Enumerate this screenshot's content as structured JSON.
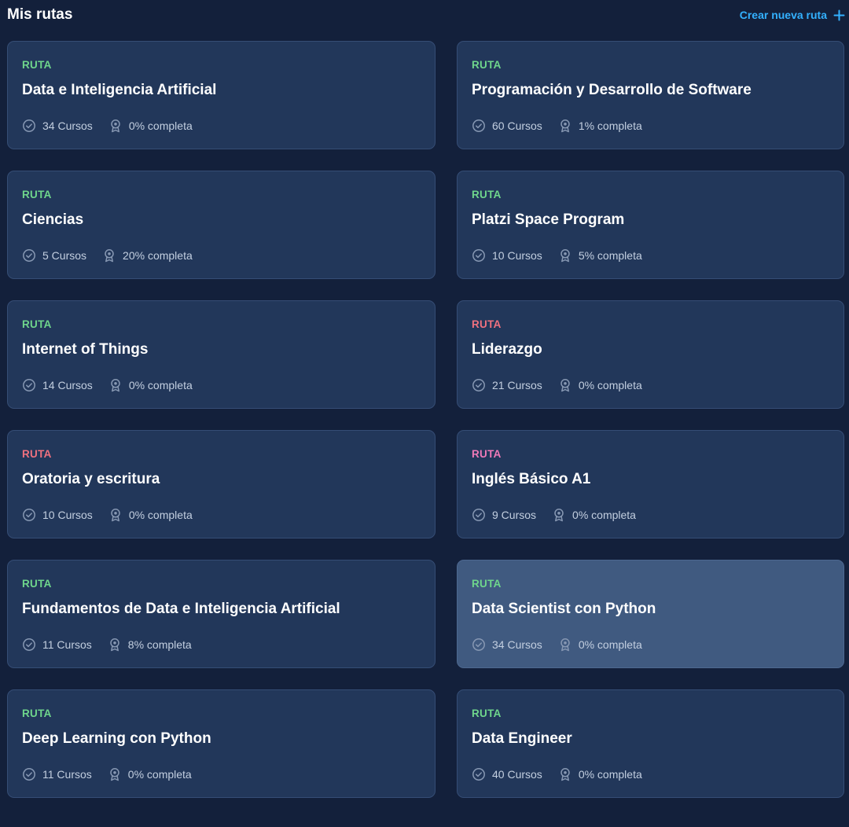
{
  "header": {
    "title": "Mis rutas",
    "create_label": "Crear nueva ruta"
  },
  "colors": {
    "green": "#6fd68c",
    "red": "#f0717f",
    "pink": "#f07ab8",
    "accent": "#33b1ff"
  },
  "routes": [
    {
      "tag": "RUTA",
      "tag_color": "green",
      "title": "Data e Inteligencia Artificial",
      "courses": "34 Cursos",
      "progress": "0% completa"
    },
    {
      "tag": "RUTA",
      "tag_color": "green",
      "title": "Programación y Desarrollo de Software",
      "courses": "60 Cursos",
      "progress": "1% completa"
    },
    {
      "tag": "RUTA",
      "tag_color": "green",
      "title": "Ciencias",
      "courses": "5 Cursos",
      "progress": "20% completa"
    },
    {
      "tag": "RUTA",
      "tag_color": "green",
      "title": "Platzi Space Program",
      "courses": "10 Cursos",
      "progress": "5% completa"
    },
    {
      "tag": "RUTA",
      "tag_color": "green",
      "title": "Internet of Things",
      "courses": "14 Cursos",
      "progress": "0% completa"
    },
    {
      "tag": "RUTA",
      "tag_color": "red",
      "title": "Liderazgo",
      "courses": "21 Cursos",
      "progress": "0% completa"
    },
    {
      "tag": "RUTA",
      "tag_color": "red",
      "title": "Oratoria y escritura",
      "courses": "10 Cursos",
      "progress": "0% completa"
    },
    {
      "tag": "RUTA",
      "tag_color": "pink",
      "title": "Inglés Básico A1",
      "courses": "9 Cursos",
      "progress": "0% completa"
    },
    {
      "tag": "RUTA",
      "tag_color": "green",
      "title": "Fundamentos de Data e Inteligencia Artificial",
      "courses": "11 Cursos",
      "progress": "8% completa"
    },
    {
      "tag": "RUTA",
      "tag_color": "green",
      "title": "Data Scientist con Python",
      "courses": "34 Cursos",
      "progress": "0% completa",
      "hovered": true
    },
    {
      "tag": "RUTA",
      "tag_color": "green",
      "title": "Deep Learning con Python",
      "courses": "11 Cursos",
      "progress": "0% completa"
    },
    {
      "tag": "RUTA",
      "tag_color": "green",
      "title": "Data Engineer",
      "courses": "40 Cursos",
      "progress": "0% completa"
    }
  ]
}
